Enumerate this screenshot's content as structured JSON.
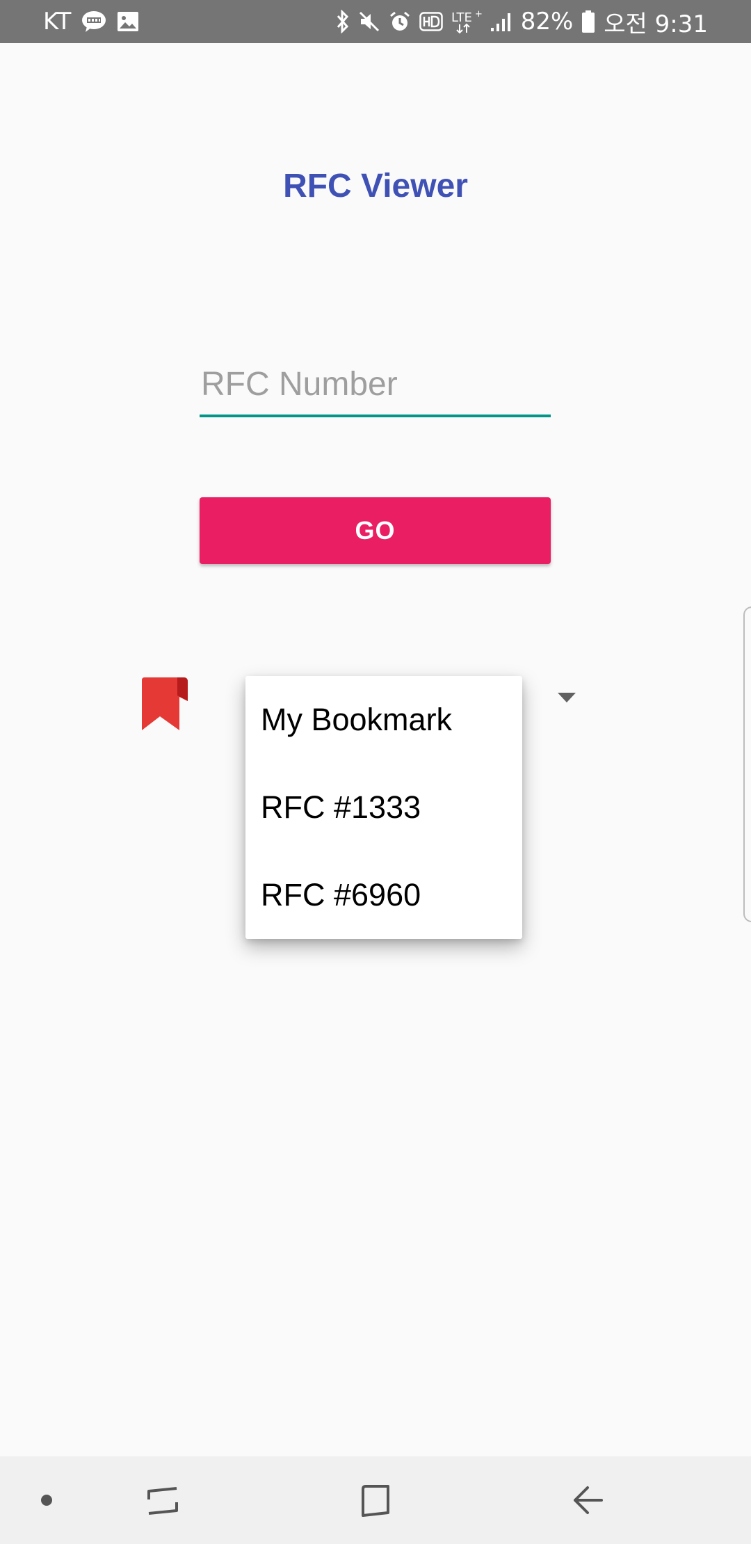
{
  "status_bar": {
    "carrier": "KT",
    "battery_percent": "82%",
    "time": "오전 9:31",
    "icons": [
      "kakaotalk-icon",
      "gallery-icon",
      "bluetooth-icon",
      "mute-icon",
      "alarm-icon",
      "hd-icon",
      "lte-icon",
      "signal-icon",
      "battery-icon"
    ]
  },
  "app": {
    "title": "RFC Viewer"
  },
  "rfc_input": {
    "placeholder": "RFC Number",
    "value": ""
  },
  "go_button": {
    "label": "GO"
  },
  "bookmark_dropdown": {
    "icon": "bookmark-icon",
    "items": [
      {
        "label": "My Bookmark"
      },
      {
        "label": "RFC #1333"
      },
      {
        "label": "RFC #6960"
      }
    ]
  },
  "navigation_bar": {
    "buttons": [
      "dot-button",
      "recents-button",
      "home-button",
      "back-button"
    ]
  },
  "colors": {
    "status_bar": "#757575",
    "title": "#3f51b5",
    "accent_underline": "#009688",
    "go_button": "#e91e63",
    "bookmark": "#e53935",
    "background": "#fafafa",
    "nav_bar": "#f0f0f0"
  }
}
